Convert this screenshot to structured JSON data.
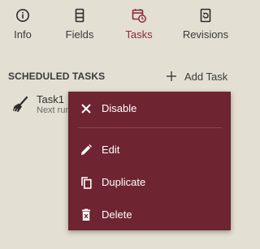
{
  "tabs": [
    {
      "id": "info",
      "label": "Info",
      "icon": "info-icon"
    },
    {
      "id": "fields",
      "label": "Fields",
      "icon": "fields-icon"
    },
    {
      "id": "tasks",
      "label": "Tasks",
      "icon": "tasks-icon",
      "active": true
    },
    {
      "id": "revisions",
      "label": "Revisions",
      "icon": "revisions-icon"
    }
  ],
  "section": {
    "title": "SCHEDULED TASKS",
    "add_label": "Add Task"
  },
  "task": {
    "name": "Task1",
    "subtitle": "Next run",
    "icon": "broom-icon"
  },
  "context_menu": {
    "items": [
      {
        "id": "disable",
        "label": "Disable",
        "icon": "close-icon"
      },
      {
        "id": "edit",
        "label": "Edit",
        "icon": "pencil-icon"
      },
      {
        "id": "duplicate",
        "label": "Duplicate",
        "icon": "copy-icon"
      },
      {
        "id": "delete",
        "label": "Delete",
        "icon": "trash-icon"
      }
    ]
  },
  "colors": {
    "background": "#e3dfd2",
    "accent": "#8a2b3a",
    "menu_background": "#6e2431",
    "text": "#3a3a3a"
  }
}
